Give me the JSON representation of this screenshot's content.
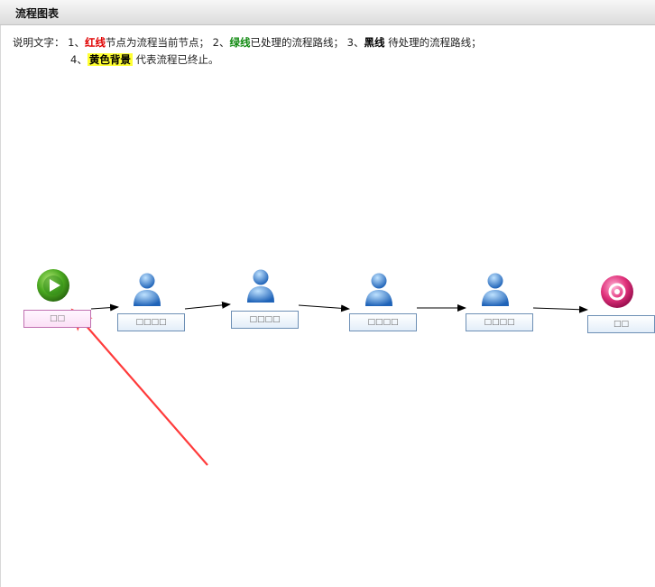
{
  "header": {
    "title": "流程图表"
  },
  "legend": {
    "prefix": "说明文字：",
    "item1_num": "1、",
    "item1_key": "红线",
    "item1_text": "节点为流程当前节点；",
    "item2_num": "2、",
    "item2_key": "绿线",
    "item2_text": "已处理的流程路线；",
    "item3_num": "3、",
    "item3_key": "黑线",
    "item3_text": " 待处理的流程路线；",
    "item4_num": "4、",
    "item4_key": "黄色背景",
    "item4_text": " 代表流程已终止。"
  },
  "flow": {
    "nodes": [
      {
        "name": "start",
        "icon": "start-play-icon",
        "label": "□□",
        "state": "current"
      },
      {
        "name": "step-1",
        "icon": "user-icon",
        "label": "□□□□"
      },
      {
        "name": "step-2",
        "icon": "user-icon",
        "label": "□□□□"
      },
      {
        "name": "step-3",
        "icon": "user-icon",
        "label": "□□□□"
      },
      {
        "name": "step-4",
        "icon": "user-icon",
        "label": "□□□□"
      },
      {
        "name": "end",
        "icon": "end-stop-icon",
        "label": "□□"
      }
    ]
  },
  "colors": {
    "annotation_arrow": "#ff3b3b",
    "flow_line": "#000000",
    "start_icon": "#3a9a1a",
    "end_icon": "#e0307a",
    "user_icon": "#2f7fd0"
  }
}
